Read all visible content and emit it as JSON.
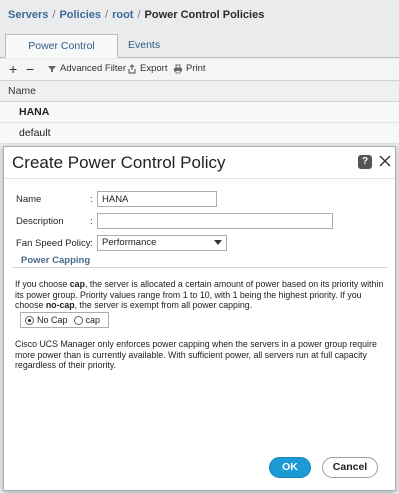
{
  "breadcrumb": {
    "items": [
      "Servers",
      "Policies",
      "root",
      "Power Control Policies"
    ],
    "separator": "/"
  },
  "tabs": [
    {
      "label": "Power Control Policies",
      "active": true
    },
    {
      "label": "Events",
      "active": false
    }
  ],
  "toolbar": {
    "add": "+",
    "remove": "−",
    "advanced_filter": "Advanced Filter",
    "export": "Export",
    "print": "Print"
  },
  "table": {
    "header": "Name",
    "rows": [
      "HANA",
      "default"
    ]
  },
  "dialog": {
    "title": "Create Power Control Policy",
    "help": "?",
    "fields": {
      "name_label": "Name",
      "name_value": "HANA",
      "description_label": "Description",
      "description_value": "",
      "fan_speed_label": "Fan Speed Policy",
      "fan_speed_value": "Performance",
      "colon": ":"
    },
    "section_title": "Power Capping",
    "capping_help": {
      "p1": "If you choose ",
      "b1": "cap",
      "p2": ", the server is allocated a certain amount of power based on its priority within its power group. Priority values range from 1 to 10, with 1 being the highest priority. If you choose ",
      "b2": "no-cap",
      "p3": ", the server is exempt from all power capping."
    },
    "radio": {
      "options": [
        "No Cap",
        "cap"
      ],
      "selected": "No Cap"
    },
    "note": "Cisco UCS Manager only enforces power capping when the servers in a power group require more power than is currently available. With sufficient power, all servers run at full capacity regardless of their priority.",
    "ok_label": "OK",
    "cancel_label": "Cancel"
  },
  "colors": {
    "primary_button": "#1b9ad6",
    "link": "#3d6b9a",
    "section_title": "#4a6a88"
  }
}
